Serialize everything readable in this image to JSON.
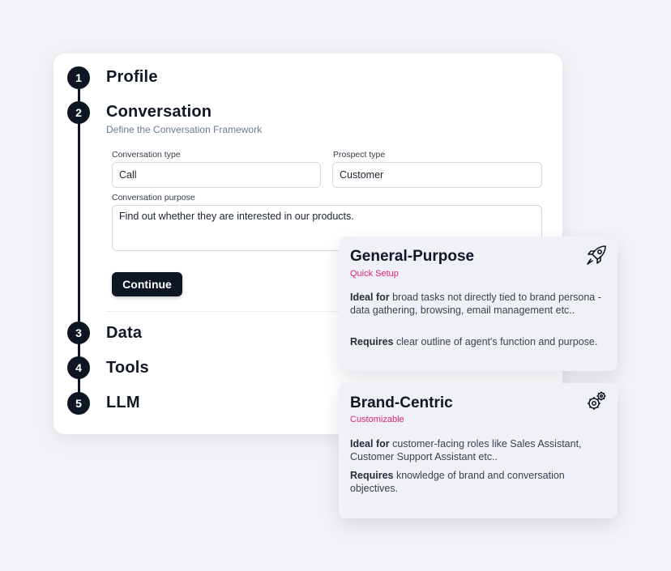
{
  "wizard": {
    "steps": [
      {
        "number": "1",
        "title": "Profile"
      },
      {
        "number": "2",
        "title": "Conversation",
        "subtitle": "Define the Conversation Framework"
      },
      {
        "number": "3",
        "title": "Data"
      },
      {
        "number": "4",
        "title": "Tools"
      },
      {
        "number": "5",
        "title": "LLM"
      }
    ],
    "conversation": {
      "type_label": "Conversation type",
      "type_value": "Call",
      "prospect_label": "Prospect type",
      "prospect_value": "Customer",
      "purpose_label": "Conversation purpose",
      "purpose_value": "Find out whether they are interested in our products."
    },
    "continue_label": "Continue"
  },
  "cards": [
    {
      "title": "General-Purpose",
      "tag": "Quick Setup",
      "icon": "rocket-icon",
      "ideal_bold": "Ideal for",
      "ideal_text": " broad tasks not directly tied to brand persona - data gathering, browsing, email management etc..",
      "requires_bold": "Requires",
      "requires_text": " clear outline of agent's function and purpose."
    },
    {
      "title": "Brand-Centric",
      "tag": "Customizable",
      "icon": "gears-icon",
      "ideal_bold": "Ideal for",
      "ideal_text": " customer-facing roles like Sales Assistant, Customer Support Assistant etc..",
      "requires_bold": "Requires",
      "requires_text": " knowledge of brand and conversation objectives."
    }
  ],
  "colors": {
    "primary": "#0f1623",
    "accent_pink": "#e0207a",
    "subtitle": "#6b7a94",
    "card_bg": "#eff1f6"
  }
}
